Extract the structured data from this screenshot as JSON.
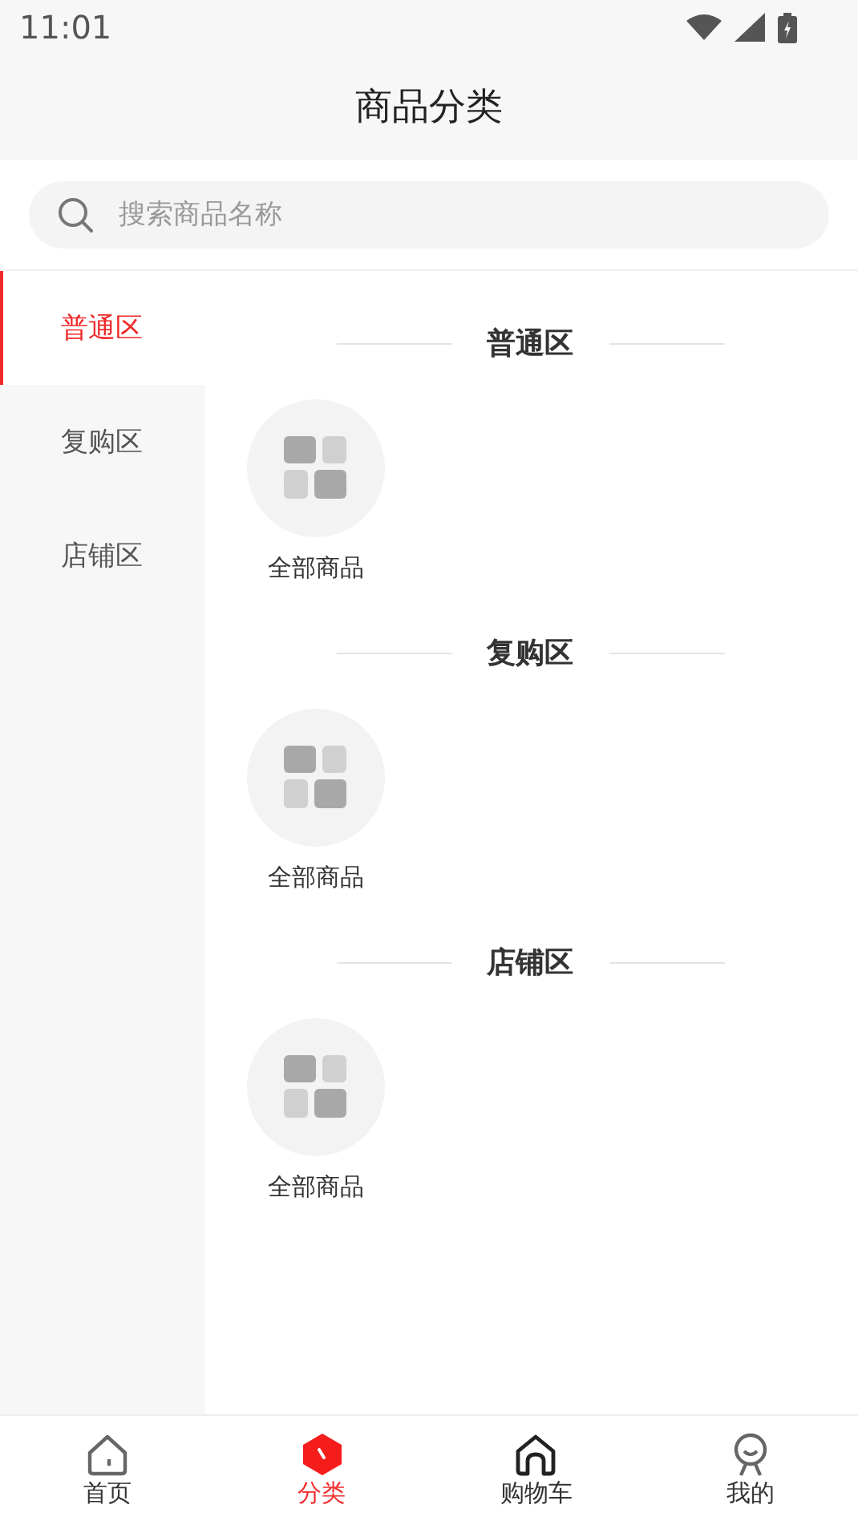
{
  "status_bar": {
    "time": "11:01"
  },
  "header": {
    "title": "商品分类"
  },
  "search": {
    "placeholder": "搜索商品名称"
  },
  "sidebar": {
    "items": [
      {
        "label": "普通区",
        "selected": true
      },
      {
        "label": "复购区",
        "selected": false
      },
      {
        "label": "店铺区",
        "selected": false
      }
    ]
  },
  "sections": [
    {
      "title": "普通区",
      "items": [
        {
          "label": "全部商品"
        }
      ]
    },
    {
      "title": "复购区",
      "items": [
        {
          "label": "全部商品"
        }
      ]
    },
    {
      "title": "店铺区",
      "items": [
        {
          "label": "全部商品"
        }
      ]
    }
  ],
  "tab_bar": [
    {
      "label": "首页",
      "selected": false
    },
    {
      "label": "分类",
      "selected": true
    },
    {
      "label": "购物车",
      "selected": false
    },
    {
      "label": "我的",
      "selected": false
    }
  ]
}
